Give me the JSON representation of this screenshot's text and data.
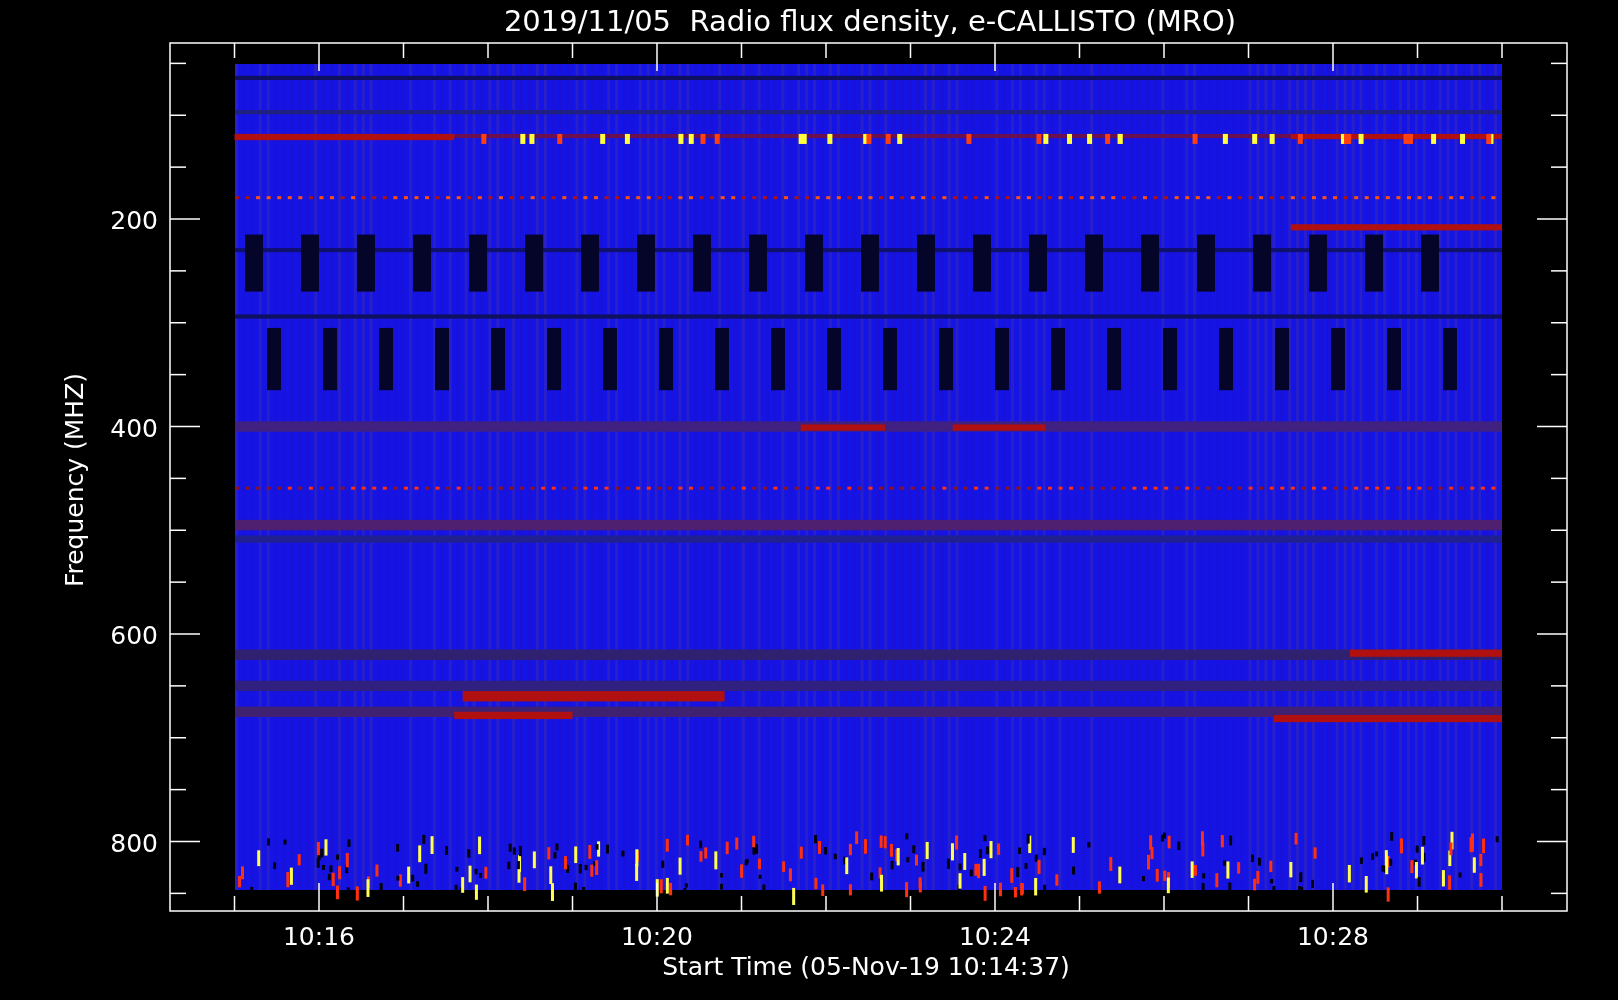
{
  "title": "2019/11/05  Radio flux density, e-CALLISTO (MRO)",
  "y_axis": {
    "label": "Frequency (MHZ)",
    "ticks": [
      "200",
      "400",
      "600",
      "800"
    ]
  },
  "x_axis": {
    "label": "Start Time (05-Nov-19 10:14:37)",
    "ticks": [
      "10:16",
      "10:20",
      "10:24",
      "10:28"
    ]
  }
}
